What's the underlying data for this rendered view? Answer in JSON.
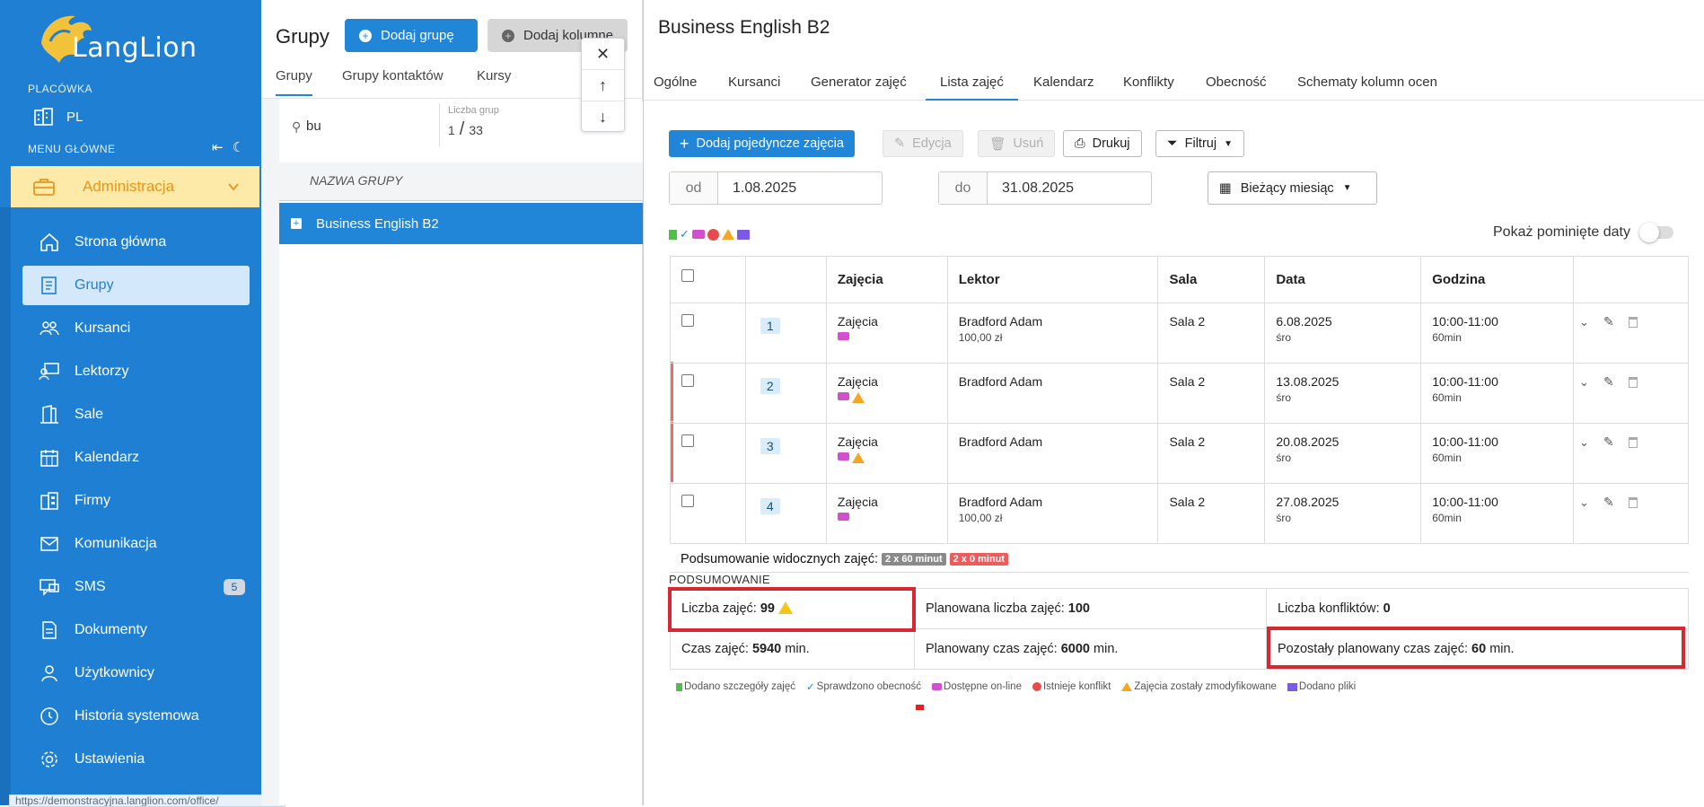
{
  "sidebar": {
    "logo_text": "LangLion",
    "branch_caption": "PLACÓWKA",
    "branch_value": "PL",
    "menu_caption": "MENU GŁÓWNE",
    "admin_label": "Administracja",
    "items": [
      {
        "label": "Strona główna",
        "icon": "home-icon"
      },
      {
        "label": "Grupy",
        "icon": "groups-icon"
      },
      {
        "label": "Kursanci",
        "icon": "students-icon"
      },
      {
        "label": "Lektorzy",
        "icon": "teachers-icon"
      },
      {
        "label": "Sale",
        "icon": "rooms-icon"
      },
      {
        "label": "Kalendarz",
        "icon": "calendar-icon"
      },
      {
        "label": "Firmy",
        "icon": "companies-icon"
      },
      {
        "label": "Komunikacja",
        "icon": "mail-icon"
      },
      {
        "label": "SMS",
        "icon": "sms-icon",
        "badge": "5"
      },
      {
        "label": "Dokumenty",
        "icon": "document-icon"
      },
      {
        "label": "Użytkownicy",
        "icon": "user-icon"
      },
      {
        "label": "Historia systemowa",
        "icon": "history-icon"
      },
      {
        "label": "Ustawienia",
        "icon": "settings-icon"
      }
    ],
    "status_url": "https://demonstracyjna.langlion.com/office/"
  },
  "middle": {
    "title": "Grupy",
    "add_group_label": "Dodaj grupę",
    "add_column_label": "Dodaj kolumnę",
    "tabs": [
      "Grupy",
      "Grupy kontaktów",
      "Kursy"
    ],
    "search_value": "bu",
    "group_count_caption": "Liczba grup",
    "group_count_shown": "1",
    "group_count_total": "33",
    "column_header": "NAZWA GRUPY",
    "groups": [
      "Business English B2"
    ]
  },
  "right": {
    "title": "Business English B2",
    "tabs": [
      "Ogólne",
      "Kursanci",
      "Generator zajęć",
      "Lista zajęć",
      "Kalendarz",
      "Konflikty",
      "Obecność",
      "Schematy kolumn ocen"
    ],
    "toolbar": {
      "add_single": "Dodaj pojedyncze zajęcia",
      "edit": "Edycja",
      "delete": "Usuń",
      "print": "Drukuj",
      "filter": "Filtruj"
    },
    "date_from_prefix": "od",
    "date_from": "1.08.2025",
    "date_to_prefix": "do",
    "date_to": "31.08.2025",
    "period_select": "Bieżący miesiąc",
    "show_skipped_label": "Pokaż pominięte daty",
    "table_headers": [
      "Zajęcia",
      "Lektor",
      "Sala",
      "Data",
      "Godzina"
    ],
    "rows": [
      {
        "num": "1",
        "type": "Zajęcia",
        "teacher": "Bradford Adam",
        "price": "100,00 zł",
        "room": "Sala 2",
        "date": "6.08.2025",
        "day": "śro",
        "time": "10:00-11:00",
        "dur": "60min",
        "warn": false
      },
      {
        "num": "2",
        "type": "Zajęcia",
        "teacher": "Bradford Adam",
        "price": "",
        "room": "Sala 2",
        "date": "13.08.2025",
        "day": "śro",
        "time": "10:00-11:00",
        "dur": "60min",
        "warn": true
      },
      {
        "num": "3",
        "type": "Zajęcia",
        "teacher": "Bradford Adam",
        "price": "",
        "room": "Sala 2",
        "date": "20.08.2025",
        "day": "śro",
        "time": "10:00-11:00",
        "dur": "60min",
        "warn": true
      },
      {
        "num": "4",
        "type": "Zajęcia",
        "teacher": "Bradford Adam",
        "price": "100,00 zł",
        "room": "Sala 2",
        "date": "27.08.2025",
        "day": "śro",
        "time": "10:00-11:00",
        "dur": "60min",
        "warn": false
      }
    ],
    "visible_summary_label": "Podsumowanie widocznych zajęć:",
    "chip_ok": "2 x 60 minut",
    "chip_zero": "2 x 0 minut",
    "summary_caption": "PODSUMOWANIE",
    "summary": {
      "lessons_label": "Liczba zajęć:",
      "lessons_value": "99",
      "planned_label": "Planowana liczba zajęć:",
      "planned_value": "100",
      "conflicts_label": "Liczba konfliktów:",
      "conflicts_value": "0",
      "time_label": "Czas zajęć:",
      "time_value": "5940",
      "time_unit": "min.",
      "planned_time_label": "Planowany czas zajęć:",
      "planned_time_value": "6000",
      "planned_time_unit": "min.",
      "remaining_label": "Pozostały planowany czas zajęć:",
      "remaining_value": "60",
      "remaining_unit": "min."
    },
    "legend": [
      "Dodano szczegóły zajęć",
      "Sprawdzono obecność",
      "Dostępne on-line",
      "Istnieje konflikt",
      "Zajęcia zostały zmodyfikowane",
      "Dodano pliki"
    ]
  },
  "colors": {
    "accent": "#2185d8",
    "sidebar": "#1f7fd3",
    "admin_bg": "#fdeaa9",
    "highlight": "#d62732"
  }
}
